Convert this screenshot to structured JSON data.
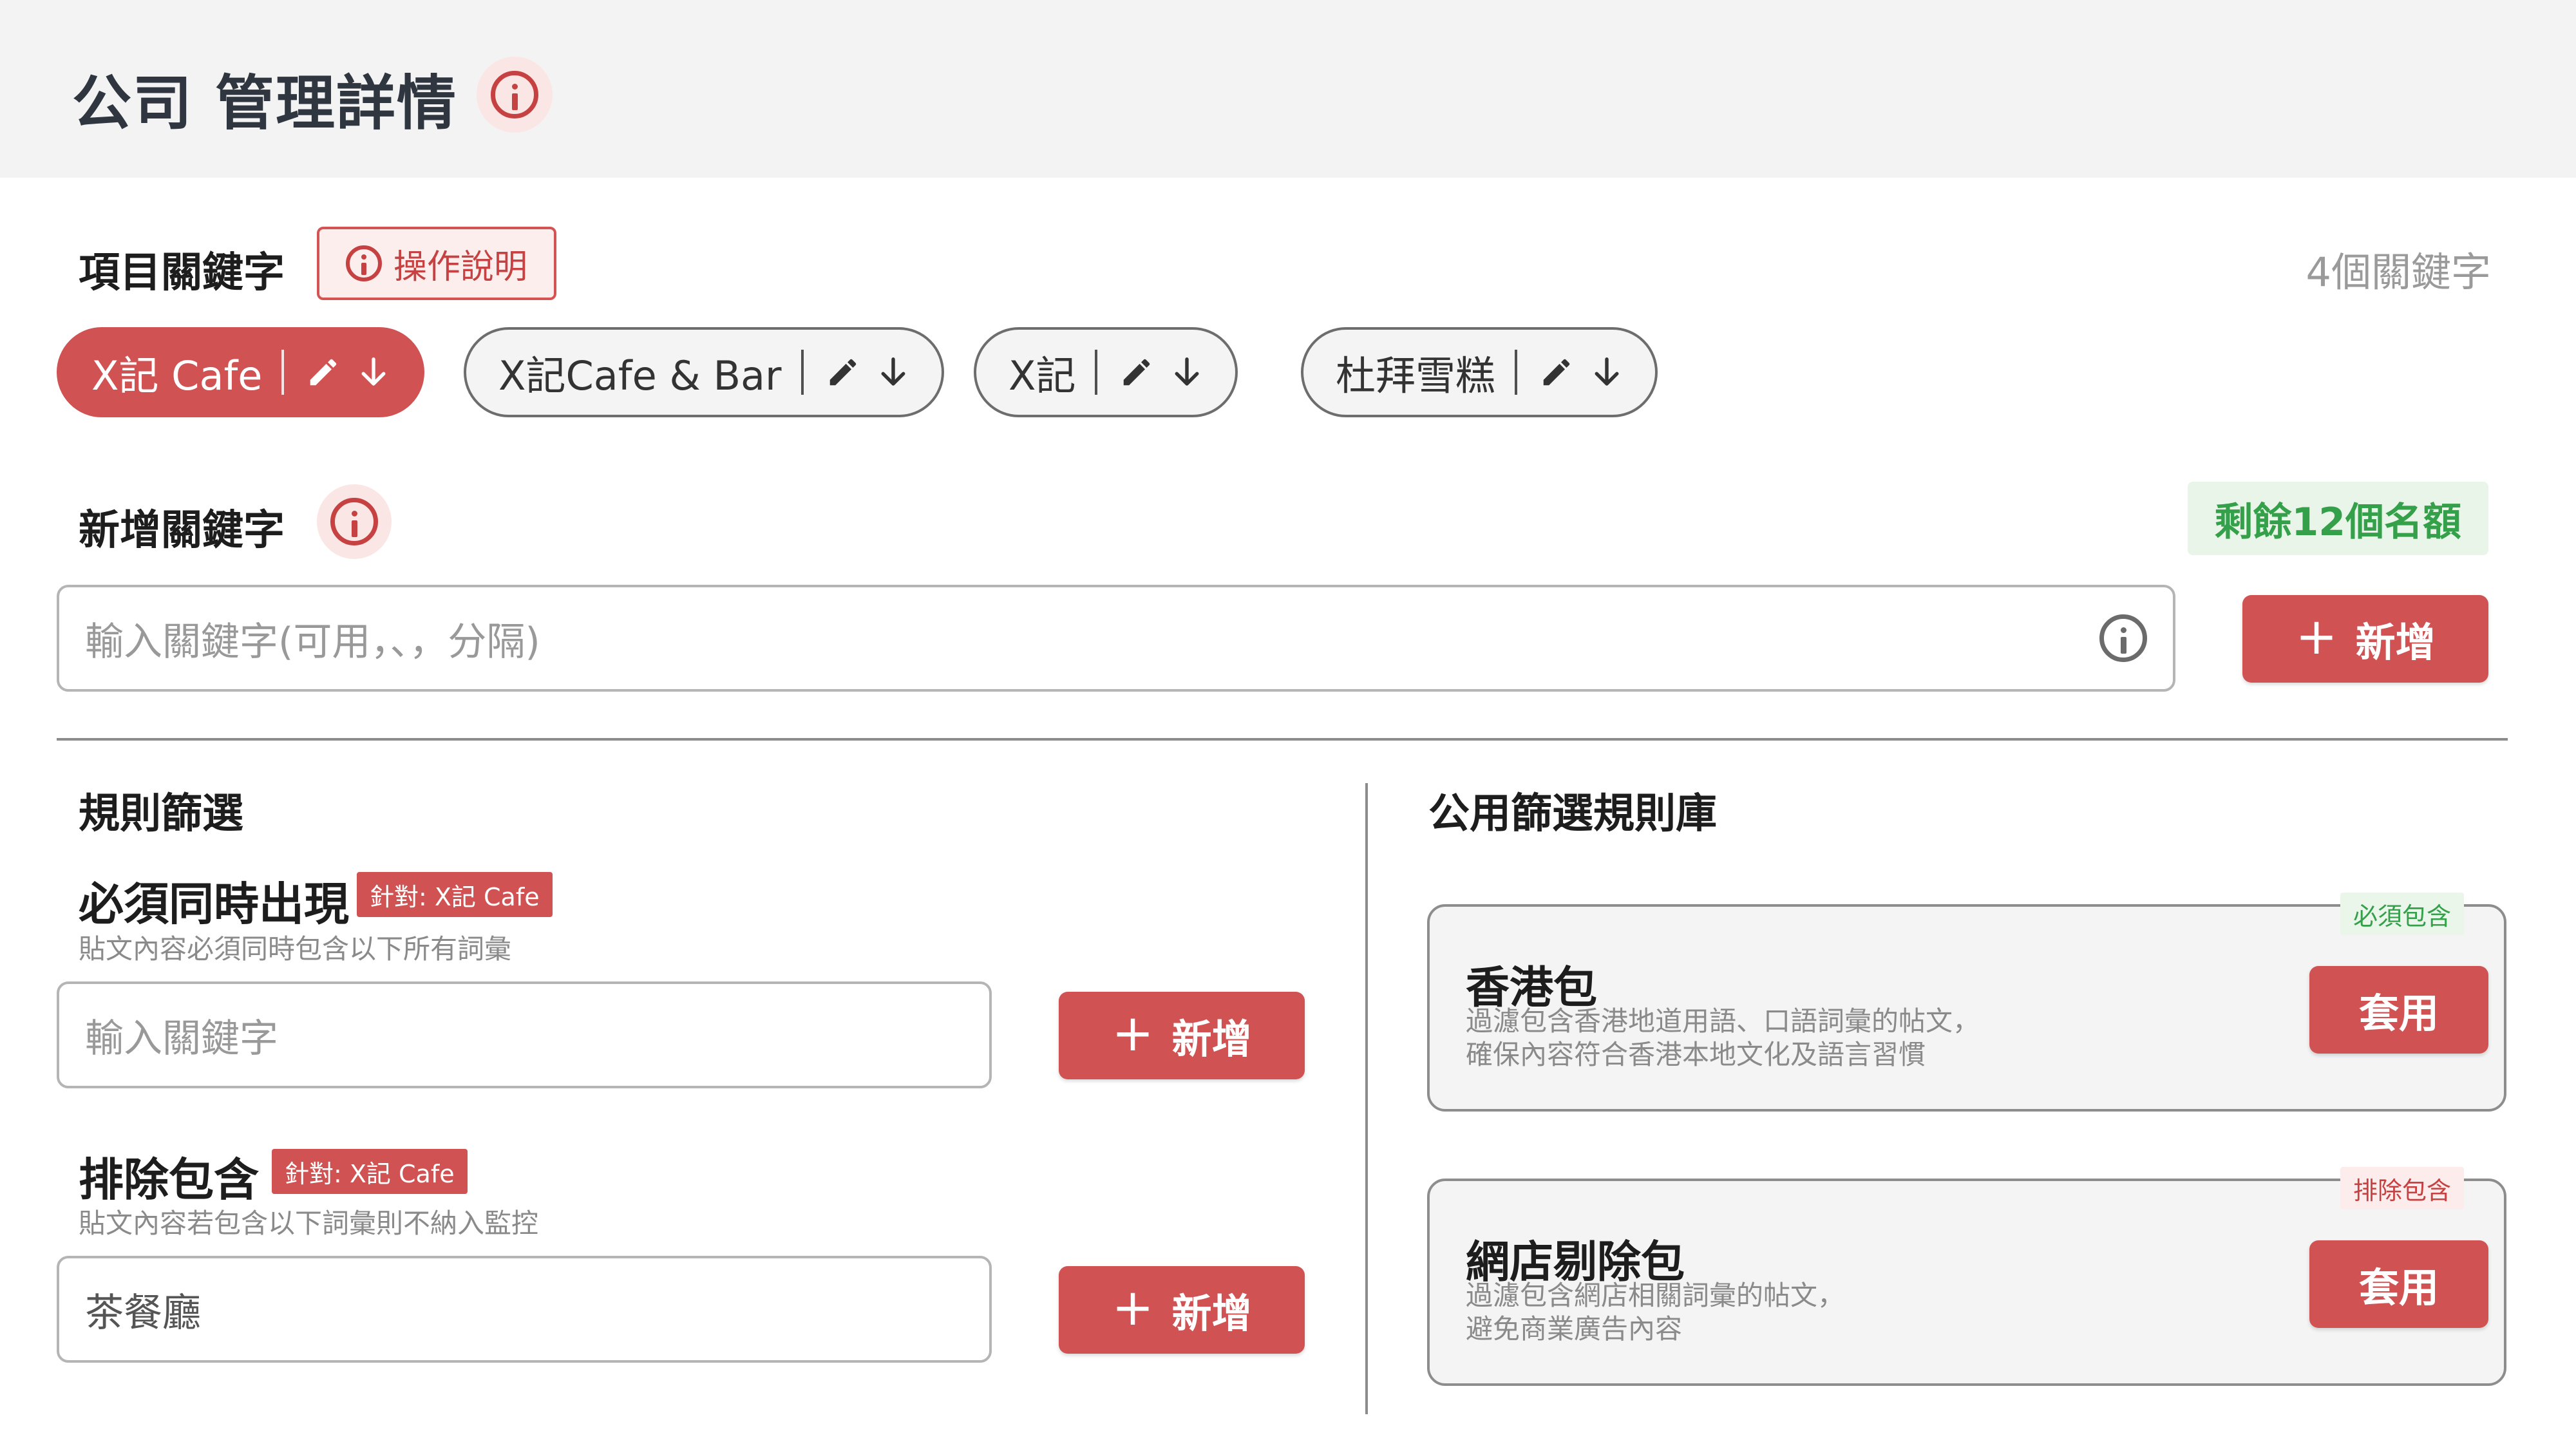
{
  "header": {
    "title": "公司 管理詳情"
  },
  "keywords_section": {
    "title": "項目關鍵字",
    "help_label": "操作說明",
    "count_label": "4個關鍵字",
    "chips": [
      {
        "label": "X記 Cafe",
        "active": true
      },
      {
        "label": "X記Cafe & Bar",
        "active": false
      },
      {
        "label": "X記",
        "active": false
      },
      {
        "label": "杜拜雪糕",
        "active": false
      }
    ]
  },
  "add_keyword": {
    "title": "新增關鍵字",
    "quota_label": "剩餘12個名額",
    "input_placeholder": "輸入關鍵字(可用，、，分隔)",
    "button_label": "新增"
  },
  "rule_filter": {
    "title": "規則篩選",
    "must_include": {
      "title": "必須同時出現",
      "target_badge": "針對: X記 Cafe",
      "description": "貼文內容必須同時包含以下所有詞彙",
      "input_placeholder": "輸入關鍵字",
      "input_value": "",
      "button_label": "新增"
    },
    "exclude": {
      "title": "排除包含",
      "target_badge": "針對: X記 Cafe",
      "description": "貼文內容若包含以下詞彙則不納入監控",
      "input_value": "茶餐廳",
      "button_label": "新增"
    }
  },
  "public_library": {
    "title": "公用篩選規則庫",
    "cards": [
      {
        "tag": "必須包含",
        "tag_color": "#34a04a",
        "title": "香港包",
        "desc_line1": "過濾包含香港地道用語、口語詞彙的帖文，",
        "desc_line2": "確保內容符合香港本地文化及語言習慣",
        "button_label": "套用"
      },
      {
        "tag": "排除包含",
        "tag_color": "#c64141",
        "title": "網店剔除包",
        "desc_line1": "過濾包含網店相關詞彙的帖文，",
        "desc_line2": "避免商業廣告內容",
        "button_label": "套用"
      }
    ]
  },
  "colors": {
    "accent": "#d05252",
    "success": "#34a04a",
    "header_bg": "#f3f3f3"
  },
  "icons": {
    "title_info": "info-icon",
    "chip_edit": "pencil-icon",
    "chip_expand": "arrow-down-icon",
    "add": "plus-icon"
  }
}
